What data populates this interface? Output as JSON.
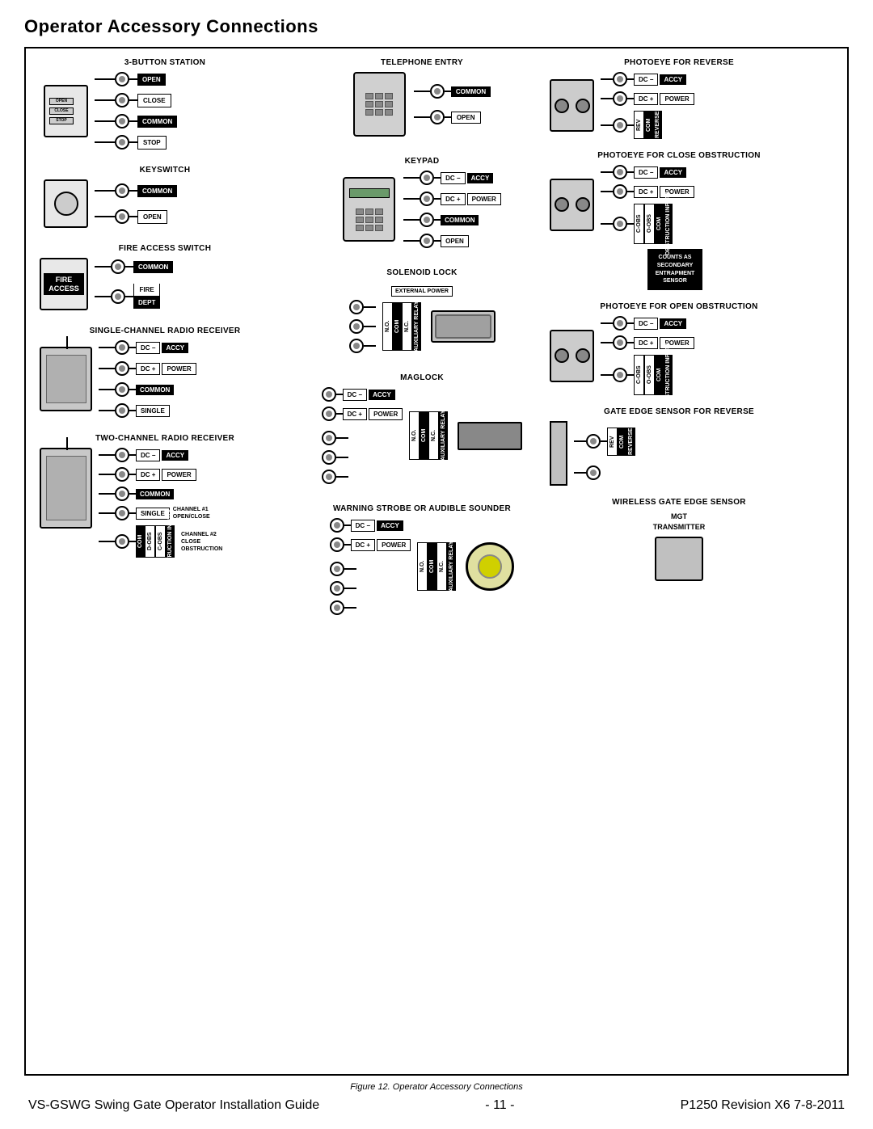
{
  "title": "Operator Accessory Connections",
  "caption": "Figure 12. Operator Accessory Connections",
  "footer": {
    "left": "VS-GSWG   Swing Gate Operator Installation Guide",
    "center": "- 11 -",
    "right": "P1250 Revision X6 7-8-2011"
  },
  "sections": {
    "btn_station": {
      "title": "3-BUTTON STATION",
      "labels": [
        "OPEN",
        "CLOSE",
        "COMMON",
        "STOP"
      ]
    },
    "telephone_entry": {
      "title": "TELEPHONE ENTRY",
      "labels": [
        "COMMON",
        "OPEN"
      ]
    },
    "photoeye_reverse": {
      "title": "PHOTOEYE FOR REVERSE",
      "labels": [
        "DC-",
        "DC+",
        "REV",
        "COM",
        "REVERSE"
      ],
      "accy_power": [
        "ACCY",
        "POWER"
      ]
    },
    "keyswitch": {
      "title": "KEYSWITCH",
      "labels": [
        "COMMON",
        "OPEN"
      ]
    },
    "keypad": {
      "title": "KEYPAD",
      "labels": [
        "DC-",
        "DC+",
        "COMMON",
        "OPEN"
      ],
      "accy_power": [
        "ACCY",
        "POWER"
      ]
    },
    "photoeye_close": {
      "title": "PHOTOEYE FOR CLOSE OBSTRUCTION",
      "labels": [
        "DC-",
        "DC+",
        "C-OBS",
        "O-OBS",
        "COM",
        "OBSTRUCTION INPUTS"
      ],
      "accy_power": [
        "ACCY",
        "POWER"
      ],
      "counts_box": [
        "COUNTS AS",
        "SECONDARY",
        "ENTRAPMENT",
        "SENSOR"
      ]
    },
    "fire_access": {
      "title": "FIRE ACCESS SWITCH",
      "device_label": [
        "FIRE",
        "ACCESS"
      ],
      "labels": [
        "COMMON",
        "FIRE",
        "DEPT"
      ]
    },
    "solenoid_lock": {
      "title": "SOLENOID LOCK",
      "ext_power": "EXTERNAL POWER",
      "labels": [
        "N.O.",
        "COM",
        "N.C.",
        "AUXILIARY RELAY"
      ]
    },
    "photoeye_open": {
      "title": "PHOTOEYE FOR OPEN OBSTRUCTION",
      "labels": [
        "DC-",
        "DC+",
        "C-OBS",
        "O-OBS",
        "COM",
        "OBSTRUCTION INPUTS"
      ],
      "accy_power": [
        "ACCY",
        "POWER"
      ]
    },
    "single_radio": {
      "title": "SINGLE-CHANNEL RADIO RECEIVER",
      "labels": [
        "DC-",
        "DC+",
        "COMMON",
        "SINGLE"
      ],
      "accy_power": [
        "ACCY",
        "POWER"
      ]
    },
    "maglock": {
      "title": "MAGLOCK",
      "labels": [
        "DC-",
        "DC+",
        "N.O.",
        "COM",
        "N.C.",
        "AUXILIARY RELAY"
      ],
      "accy_power": [
        "ACCY",
        "POWER"
      ]
    },
    "gate_edge_reverse": {
      "title": "GATE EDGE SENSOR FOR REVERSE",
      "labels": [
        "REV",
        "COM",
        "REVERSE"
      ]
    },
    "two_radio": {
      "title": "TWO-CHANNEL RADIO RECEIVER",
      "labels": [
        "DC-",
        "DC+",
        "COMMON",
        "SINGLE"
      ],
      "accy_power": [
        "ACCY",
        "POWER"
      ],
      "ch1": "CHANNEL #1\nOPEN/CLOSE",
      "ch2": "CHANNEL #2\nCLOSE\nOBSTRUCTION",
      "obstruction": [
        "COM",
        "D-OBS",
        "C-OBS",
        "OBSTRUCTION INPUTS"
      ]
    },
    "warning_strobe": {
      "title": "WARNING STROBE OR AUDIBLE SOUNDER",
      "labels": [
        "DC-",
        "DC+",
        "N.O.",
        "COM",
        "N.C.",
        "AUXILIARY RELAY"
      ],
      "accy_power": [
        "ACCY",
        "POWER"
      ]
    },
    "wireless_gate_edge": {
      "title": "WIRELESS GATE EDGE SENSOR",
      "subtitle": "MGT\nTRANSMITTER"
    }
  }
}
